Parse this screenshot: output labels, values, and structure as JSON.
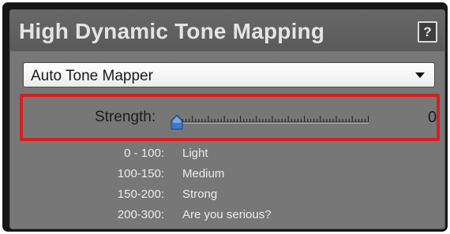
{
  "panel": {
    "title": "High Dynamic Tone Mapping",
    "help_label": "?"
  },
  "mode_select": {
    "selected": "Auto Tone Mapper"
  },
  "strength": {
    "label": "Strength:",
    "value": "0",
    "min": 0,
    "max": 300
  },
  "legend": [
    {
      "range": "0  -  100:",
      "desc": "Light"
    },
    {
      "range": "100-150:",
      "desc": "Medium"
    },
    {
      "range": "150-200:",
      "desc": "Strong"
    },
    {
      "range": "200-300:",
      "desc": "Are you serious?"
    }
  ],
  "colors": {
    "highlight": "#d62020",
    "thumb": "#3f78c8"
  },
  "icons": {
    "dropdown": "chevron-down-icon",
    "help": "help-icon"
  }
}
